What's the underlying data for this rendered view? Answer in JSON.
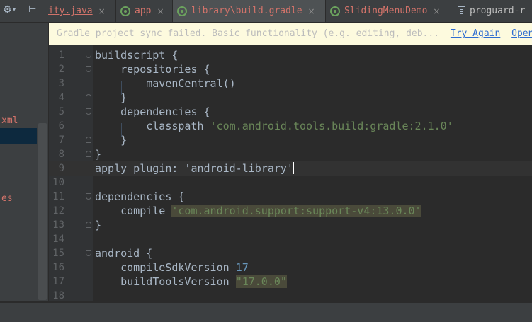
{
  "tabs": [
    {
      "label": "ity.java",
      "icon": "java-file-icon"
    },
    {
      "label": "app",
      "icon": "android-module-icon"
    },
    {
      "label": "library\\build.gradle",
      "icon": "android-module-icon",
      "active": true
    },
    {
      "label": "SlidingMenuDemo",
      "icon": "android-module-icon"
    },
    {
      "label": "proguard-r",
      "icon": "text-file-icon"
    }
  ],
  "tab_close_glyph": "×",
  "toolbar": {
    "gear_glyph": "⚙",
    "arrow_glyph": "▾",
    "hide_glyph": "⊢"
  },
  "project_panel": {
    "item1": "xml",
    "item2": "es"
  },
  "notification": {
    "message": "Gradle project sync failed. Basic functionality (e.g. editing, deb...",
    "try_again": "Try Again",
    "open": "Open"
  },
  "editor": {
    "lines": [
      {
        "n": "1",
        "tokens": [
          {
            "t": "buildscript {"
          }
        ],
        "fold": "open"
      },
      {
        "n": "2",
        "tokens": [
          {
            "t": "    repositories {"
          }
        ],
        "fold": "open"
      },
      {
        "n": "3",
        "tokens": [
          {
            "t": "        mavenCentral()"
          }
        ]
      },
      {
        "n": "4",
        "tokens": [
          {
            "t": "    }"
          }
        ],
        "fold": "close"
      },
      {
        "n": "5",
        "tokens": [
          {
            "t": "    dependencies {"
          }
        ],
        "fold": "open"
      },
      {
        "n": "6",
        "tokens": [
          {
            "t": "        classpath "
          },
          {
            "t": "'com.android.tools.build:gradle:2.1.0'",
            "c": "str"
          }
        ]
      },
      {
        "n": "7",
        "tokens": [
          {
            "t": "    }"
          }
        ],
        "fold": "close"
      },
      {
        "n": "8",
        "tokens": [
          {
            "t": "}"
          }
        ],
        "fold": "close"
      },
      {
        "n": "9",
        "tokens": [
          {
            "t": "apply plugin: 'android-library'",
            "c": "uline"
          }
        ],
        "current": true,
        "caret": true
      },
      {
        "n": "10",
        "tokens": []
      },
      {
        "n": "11",
        "tokens": [
          {
            "t": "dependencies {"
          }
        ],
        "fold": "open"
      },
      {
        "n": "12",
        "tokens": [
          {
            "t": "    compile "
          },
          {
            "t": "'com.android.support:support-v4:13.0.0'",
            "c": "strhl"
          }
        ]
      },
      {
        "n": "13",
        "tokens": [
          {
            "t": "}"
          }
        ],
        "fold": "close"
      },
      {
        "n": "14",
        "tokens": []
      },
      {
        "n": "15",
        "tokens": [
          {
            "t": "android {"
          }
        ],
        "fold": "open"
      },
      {
        "n": "16",
        "tokens": [
          {
            "t": "    compileSdkVersion "
          },
          {
            "t": "17",
            "c": "num"
          }
        ]
      },
      {
        "n": "17",
        "tokens": [
          {
            "t": "    buildToolsVersion "
          },
          {
            "t": "\"17.0.0\"",
            "c": "strhl"
          }
        ]
      },
      {
        "n": "18",
        "tokens": []
      }
    ]
  },
  "colors": {
    "editor_bg": "#2b2b2b",
    "keyword_text": "#a9b7c6",
    "string": "#6a8759",
    "number": "#6897bb",
    "notification_bg": "#fdfade",
    "link": "#2d6cd1",
    "tab_label": "#d2736a"
  }
}
